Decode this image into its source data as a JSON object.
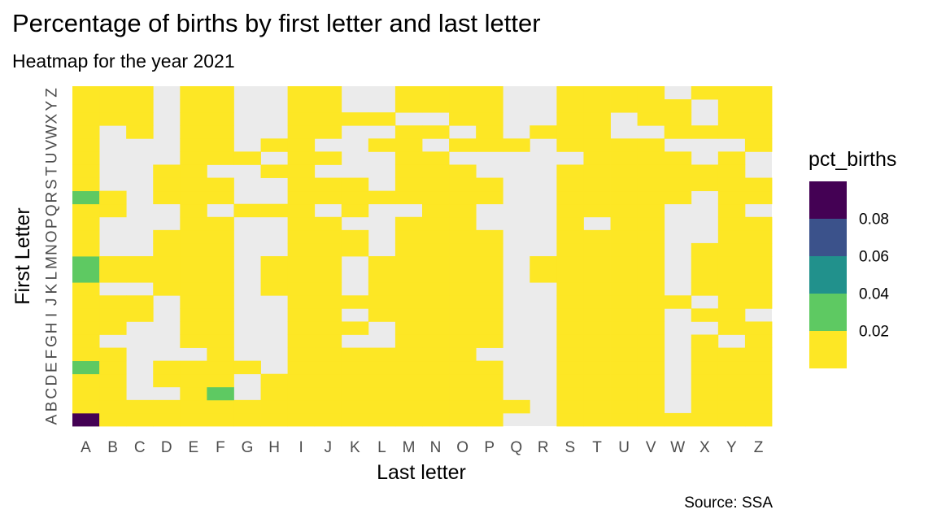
{
  "chart_data": {
    "type": "heatmap",
    "title": "Percentage of births by first letter and last letter",
    "subtitle": "Heatmap for the year 2021",
    "xlabel": "Last letter",
    "ylabel": "First Letter",
    "caption": "Source: SSA",
    "x_categories": [
      "A",
      "B",
      "C",
      "D",
      "E",
      "F",
      "G",
      "H",
      "I",
      "J",
      "K",
      "L",
      "M",
      "N",
      "O",
      "P",
      "Q",
      "R",
      "S",
      "T",
      "U",
      "V",
      "W",
      "X",
      "Y",
      "Z"
    ],
    "y_categories": [
      "A",
      "B",
      "C",
      "D",
      "E",
      "F",
      "G",
      "H",
      "I",
      "J",
      "K",
      "L",
      "M",
      "N",
      "O",
      "P",
      "Q",
      "R",
      "S",
      "T",
      "U",
      "V",
      "W",
      "X",
      "Y",
      "Z"
    ],
    "missing_color": "#ebebeb",
    "legend": {
      "title": "pct_births",
      "labels": [
        "0.08",
        "0.06",
        "0.04",
        "0.02"
      ],
      "bins": [
        {
          "range": [
            0.08,
            0.1
          ],
          "color": "#440154"
        },
        {
          "range": [
            0.06,
            0.08
          ],
          "color": "#3b528b"
        },
        {
          "range": [
            0.04,
            0.06
          ],
          "color": "#21918c"
        },
        {
          "range": [
            0.02,
            0.04
          ],
          "color": "#5ec962"
        },
        {
          "range": [
            0.0,
            0.02
          ],
          "color": "#fde725"
        }
      ]
    },
    "value_encoding": "Rows listed from first letter A (bottom) to Z (top); each string has one character per last letter A..Z. Y = below 0.02, G = 0.02-0.04, P = above 0.08, . = no births.",
    "rows": [
      "PYYYYYYYYYYYYYYY..YYYYYYYYYY",
      "YYYYYYYYYYYYYYYYY.YYYY.YYYY",
      "YY..YG.YYYYYYYYY..YYYY.YYYY",
      "YY.YYY.YYYYYYYYY..YYYY.YYYY",
      "GY.YYYY.YYYYYYYY..YYYY.YYYY",
      "YY...Y..YYYYYYY...YYYY.YYY.",
      "Y...YY..YY..YYYY..YYYY.Y.YY",
      "YY..YY..YYY.YYYY..YYYY..YYY",
      "YYY.YY..YY.YYYYY..YYYY.YY.YY",
      "YYY.YY..YYYYYYYY..YYYYY.YYY",
      "Y..YYY.YYY.YYYYY..YYYY.YYYY",
      "GYYYYY.YYY.YYYYY.YYYYY.YYYY",
      "GYYYYY.YYY.YYYYY.YYYYY.YYYY",
      "Y..YYY..YYY.YYYY..YYYY.YYYY",
      "Y..YYY..YYY.YYYY..YYYY..YY.",
      "Y...YY..YY..YYY...Y.YY..YYY",
      "YY..Y.YYY.Y..YY...YYYY..Y.",
      "GY.YYY..YYYYYYYY..YYYYY.YY.",
      "Y..YYY..YYY.YYYY..YYYYYYYYY",
      "Y..YY..YY...YYY...YYYYYYY..",
      "Y...YYY.YY..YY.....YYYY.Y.",
      "Y...YY.YY..YY.YYY.YYYY...Y.",
      "Y.Y.YY..YY..YY.Y.YYY..YYYY.",
      "YYY.YY..YYYY..YY..YY.YY.YY.",
      "YYY.YY..YY..YYYY..YYYYY.YYYY",
      "YYY.YY..YY..YYYY..YYYY.YYYY."
    ]
  }
}
